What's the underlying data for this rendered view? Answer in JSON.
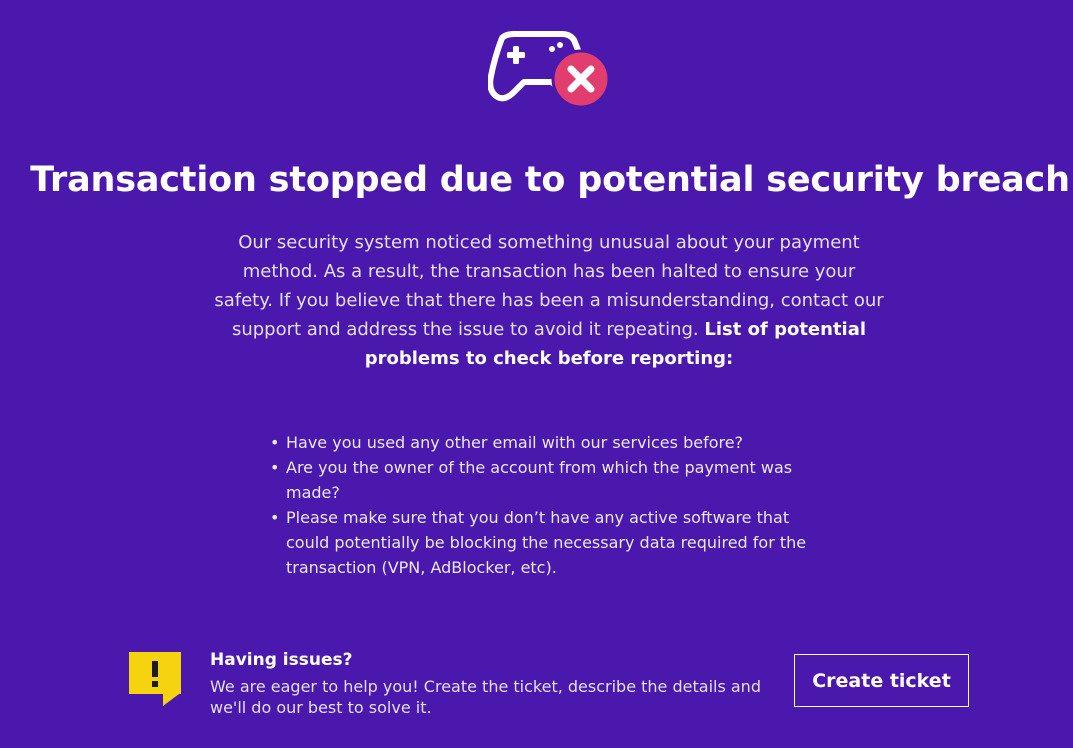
{
  "hero": {
    "icon": "gamepad-error-icon",
    "title": "Transaction stopped due to potential security breach"
  },
  "description": {
    "text": "Our security system noticed something unusual about your payment method. As a result, the transaction has been halted to ensure your safety. If you believe that there has been a misunderstanding, contact our support and address the issue to avoid it repeating. ",
    "emphasis": "List of potential problems to check before reporting:"
  },
  "problems": [
    "Have you used any other email with our services before?",
    "Are you the owner of the account from which the payment was made?",
    "Please make sure that you don’t have any active software that could potentially be blocking the necessary data required for the transaction (VPN, AdBlocker, etc)."
  ],
  "support": {
    "icon": "warning-speech-bubble-icon",
    "title": "Having issues?",
    "text": "We are eager to help you! Create the ticket, describe the details and we'll do our best to solve it.",
    "button_label": "Create ticket"
  },
  "colors": {
    "background": "#4a18ac",
    "error_badge": "#e23d6f",
    "warning": "#f5d40f",
    "text": "#ffffff"
  }
}
